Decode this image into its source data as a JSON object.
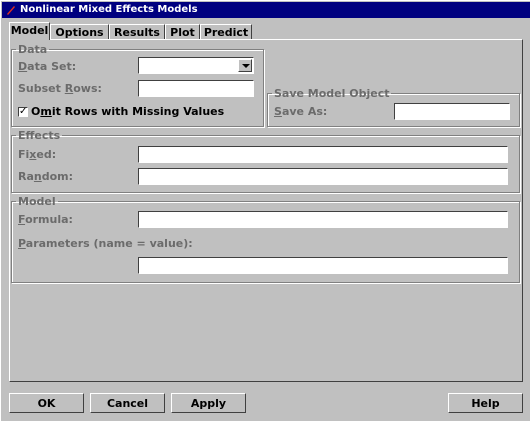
{
  "window": {
    "title": "Nonlinear Mixed Effects Models"
  },
  "tabs": [
    "Model",
    "Options",
    "Results",
    "Plot",
    "Predict"
  ],
  "data_group": {
    "legend": "Data",
    "data_set_label_u": "D",
    "data_set_label_rest": "ata Set:",
    "data_set_value": "",
    "subset_rows_label_pre": "Subset ",
    "subset_rows_label_u": "R",
    "subset_rows_label_post": "ows:",
    "subset_rows_value": "",
    "omit_label_pre": "O",
    "omit_label_u": "m",
    "omit_label_post": "it Rows with Missing Values",
    "omit_checked_glyph": "✓"
  },
  "save_group": {
    "legend": "Save Model Object",
    "save_as_label_u": "S",
    "save_as_label_rest": "ave As:",
    "save_as_value": ""
  },
  "effects_group": {
    "legend": "Effects",
    "fixed_label_pre": "Fi",
    "fixed_label_u": "x",
    "fixed_label_post": "ed:",
    "fixed_value": "",
    "random_label_pre": "Ra",
    "random_label_u": "n",
    "random_label_post": "dom:",
    "random_value": ""
  },
  "model_group": {
    "legend": "Model",
    "formula_label_u": "F",
    "formula_label_rest": "ormula:",
    "formula_value": "",
    "params_label_u": "P",
    "params_label_rest": "arameters (name = value):",
    "params_value": ""
  },
  "buttons": {
    "ok": "OK",
    "cancel": "Cancel",
    "apply": "Apply",
    "help": "Help"
  },
  "colors": {
    "title_bar": "#000080",
    "face": "#c0c0c0",
    "label_grey": "#6b6b6b"
  }
}
